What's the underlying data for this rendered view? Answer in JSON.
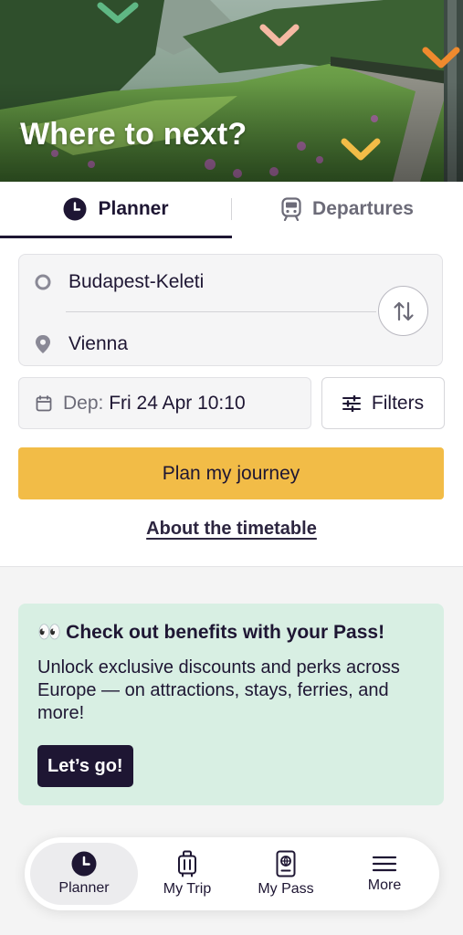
{
  "hero": {
    "title": "Where to next?"
  },
  "tabs": [
    {
      "label": "Planner",
      "icon": "clock-icon",
      "active": true
    },
    {
      "label": "Departures",
      "icon": "train-icon",
      "active": false
    }
  ],
  "route": {
    "from": "Budapest-Keleti",
    "to": "Vienna"
  },
  "date": {
    "prefix": "Dep:",
    "value": "Fri 24 Apr 10:10"
  },
  "filters_label": "Filters",
  "plan_button": "Plan my journey",
  "timetable_link": "About the timetable",
  "promo": {
    "emoji": "👀",
    "title": "Check out benefits with your Pass!",
    "body": "Unlock exclusive discounts and perks across Europe — on attractions, stays, ferries, and more!",
    "button": "Let’s go!"
  },
  "bottom_nav": [
    {
      "label": "Planner",
      "icon": "clock-icon",
      "active": true
    },
    {
      "label": "My Trip",
      "icon": "luggage-icon",
      "active": false
    },
    {
      "label": "My Pass",
      "icon": "passport-icon",
      "active": false
    },
    {
      "label": "More",
      "icon": "menu-icon",
      "active": false
    }
  ],
  "colors": {
    "primary_dark": "#1e1633",
    "accent_yellow": "#f2bc47",
    "promo_bg": "#d8efe3"
  }
}
